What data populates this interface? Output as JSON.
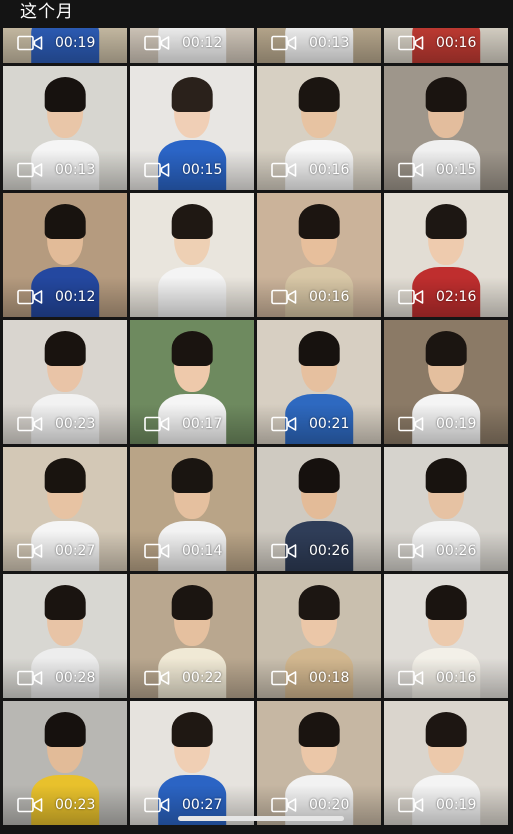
{
  "header": {
    "title": "这个月"
  },
  "colors": {
    "background": "#151515",
    "text": "#ffffff"
  },
  "videos": [
    {
      "duration": "00:19",
      "bg": "#c9bda5",
      "skin": "#e8c4a6",
      "hair": "#1a1410",
      "shirt": "#2d5db8"
    },
    {
      "duration": "00:12",
      "bg": "#d2c8bb",
      "skin": "#eccaae",
      "hair": "#1b1512",
      "shirt": "#f3f3f3"
    },
    {
      "duration": "00:13",
      "bg": "#b9a98e",
      "skin": "#e6c19f",
      "hair": "#1d1713",
      "shirt": "#f2f2f2"
    },
    {
      "duration": "00:16",
      "bg": "#d9d3c7",
      "skin": "#eec9ad",
      "hair": "#201914",
      "shirt": "#c23b33"
    },
    {
      "duration": "00:13",
      "bg": "#d7d6d0",
      "skin": "#e9c6a8",
      "hair": "#17120f",
      "shirt": "#f5f5f5"
    },
    {
      "duration": "00:15",
      "bg": "#e8e6e3",
      "skin": "#f0cfb6",
      "hair": "#2a211b",
      "shirt": "#2b65c7"
    },
    {
      "duration": "00:16",
      "bg": "#d7d0c3",
      "skin": "#e7c3a2",
      "hair": "#1b1511",
      "shirt": "#f6f6f6"
    },
    {
      "duration": "00:15",
      "bg": "#9e968b",
      "skin": "#e3bd9d",
      "hair": "#1a1410",
      "shirt": "#f0f0f0"
    },
    {
      "duration": "00:12",
      "bg": "#b59b7f",
      "skin": "#e2bb98",
      "hair": "#18130f",
      "shirt": "#2448a0"
    },
    {
      "duration": "",
      "bg": "#e9e5dd",
      "skin": "#eed0b4",
      "hair": "#1f1813",
      "shirt": "#f4f4f4"
    },
    {
      "duration": "00:16",
      "bg": "#cbb39a",
      "skin": "#e7bf9c",
      "hair": "#1c1511",
      "shirt": "#d8c7a6"
    },
    {
      "duration": "02:16",
      "bg": "#e2ddd4",
      "skin": "#eecbae",
      "hair": "#1d1713",
      "shirt": "#bf2e2e"
    },
    {
      "duration": "00:23",
      "bg": "#d9d5cf",
      "skin": "#e9c4a7",
      "hair": "#19130f",
      "shirt": "#f2f2f2"
    },
    {
      "duration": "00:17",
      "bg": "#6e8a5f",
      "skin": "#eec9ab",
      "hair": "#1a1410",
      "shirt": "#f5f5f5"
    },
    {
      "duration": "00:21",
      "bg": "#d7cfc2",
      "skin": "#e6c09f",
      "hair": "#17120f",
      "shirt": "#2e69c0"
    },
    {
      "duration": "00:19",
      "bg": "#8b7a66",
      "skin": "#e4bf9e",
      "hair": "#1b1511",
      "shirt": "#f4f4f4"
    },
    {
      "duration": "00:27",
      "bg": "#d3c8b6",
      "skin": "#e7c3a3",
      "hair": "#19140f",
      "shirt": "#f5f5f5"
    },
    {
      "duration": "00:14",
      "bg": "#b9a487",
      "skin": "#e5c09f",
      "hair": "#1a1511",
      "shirt": "#f2f2f2"
    },
    {
      "duration": "00:26",
      "bg": "#cfcac1",
      "skin": "#e3bb98",
      "hair": "#16110e",
      "shirt": "#2f3d58"
    },
    {
      "duration": "00:26",
      "bg": "#d6d3cd",
      "skin": "#e6c2a3",
      "hair": "#18130f",
      "shirt": "#f3f3f3"
    },
    {
      "duration": "00:28",
      "bg": "#d8d7d2",
      "skin": "#e8c4a6",
      "hair": "#1a1410",
      "shirt": "#ededed"
    },
    {
      "duration": "00:22",
      "bg": "#b9a78f",
      "skin": "#e5c09f",
      "hair": "#1b1511",
      "shirt": "#f0e9d5"
    },
    {
      "duration": "00:18",
      "bg": "#c9bfae",
      "skin": "#ebc7a8",
      "hair": "#1c1612",
      "shirt": "#d2b78f"
    },
    {
      "duration": "00:16",
      "bg": "#e0ddd8",
      "skin": "#eccaad",
      "hair": "#1a1410",
      "shirt": "#f3f0e8"
    },
    {
      "duration": "00:23",
      "bg": "#b8b7b3",
      "skin": "#e2bb98",
      "hair": "#16110e",
      "shirt": "#e8c12c"
    },
    {
      "duration": "00:27",
      "bg": "#e6e3de",
      "skin": "#f0cfb4",
      "hair": "#1f1813",
      "shirt": "#2b64c4"
    },
    {
      "duration": "00:20",
      "bg": "#c6b7a3",
      "skin": "#ebc7a8",
      "hair": "#1a1410",
      "shirt": "#f2f2f2"
    },
    {
      "duration": "00:19",
      "bg": "#dad5cd",
      "skin": "#ecc9ab",
      "hair": "#1d1612",
      "shirt": "#f4f4f4"
    }
  ]
}
